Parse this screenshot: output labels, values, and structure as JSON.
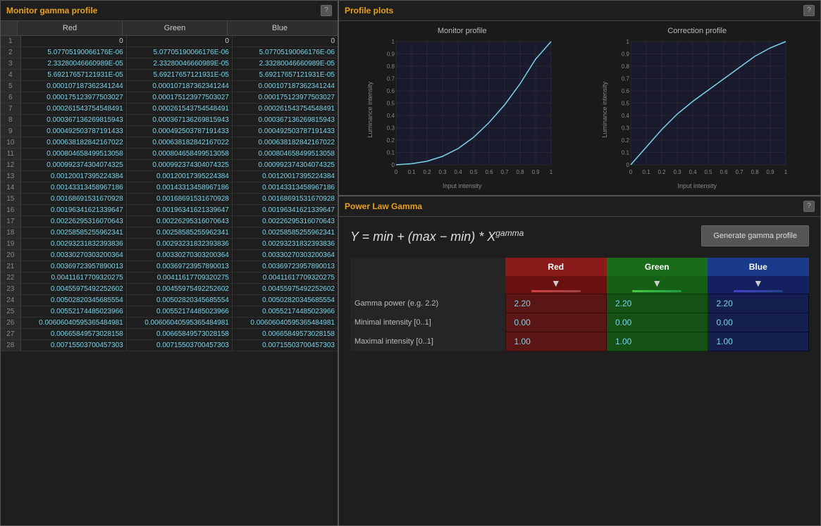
{
  "leftPanel": {
    "title": "Monitor gamma profile",
    "help": "?",
    "columns": [
      "Red",
      "Green",
      "Blue"
    ],
    "rows": [
      {
        "num": 1,
        "r": "0",
        "g": "0",
        "b": "0"
      },
      {
        "num": 2,
        "r": "5.07705190066176E-06",
        "g": "5.07705190066176E-06",
        "b": "5.07705190066176E-06"
      },
      {
        "num": 3,
        "r": "2.33280046660989E-05",
        "g": "2.33280046660989E-05",
        "b": "2.33280046660989E-05"
      },
      {
        "num": 4,
        "r": "5.69217657121931E-05",
        "g": "5.69217657121931E-05",
        "b": "5.69217657121931E-05"
      },
      {
        "num": 5,
        "r": "0.000107187362341244",
        "g": "0.000107187362341244",
        "b": "0.000107187362341244"
      },
      {
        "num": 6,
        "r": "0.000175123977503027",
        "g": "0.000175123977503027",
        "b": "0.000175123977503027"
      },
      {
        "num": 7,
        "r": "0.000261543754548491",
        "g": "0.000261543754548491",
        "b": "0.000261543754548491"
      },
      {
        "num": 8,
        "r": "0.000367136269815943",
        "g": "0.000367136269815943",
        "b": "0.000367136269815943"
      },
      {
        "num": 9,
        "r": "0.000492503787191433",
        "g": "0.000492503787191433",
        "b": "0.000492503787191433"
      },
      {
        "num": 10,
        "r": "0.000638182842167022",
        "g": "0.000638182842167022",
        "b": "0.000638182842167022"
      },
      {
        "num": 11,
        "r": "0.000804658499513058",
        "g": "0.000804658499513058",
        "b": "0.000804658499513058"
      },
      {
        "num": 12,
        "r": "0.000992374304074325",
        "g": "0.000992374304074325",
        "b": "0.000992374304074325"
      },
      {
        "num": 13,
        "r": "0.00120017395224384",
        "g": "0.00120017395224384",
        "b": "0.00120017395224384"
      },
      {
        "num": 14,
        "r": "0.00143313458967186",
        "g": "0.00143313458967186",
        "b": "0.00143313458967186"
      },
      {
        "num": 15,
        "r": "0.00168691531670928",
        "g": "0.00168691531670928",
        "b": "0.00168691531670928"
      },
      {
        "num": 16,
        "r": "0.00196341621339647",
        "g": "0.00196341621339647",
        "b": "0.00196341621339647"
      },
      {
        "num": 17,
        "r": "0.00226295316070643",
        "g": "0.00226295316070643",
        "b": "0.00226295316070643"
      },
      {
        "num": 18,
        "r": "0.00258585255962341",
        "g": "0.00258585255962341",
        "b": "0.00258585255962341"
      },
      {
        "num": 19,
        "r": "0.00293231832393836",
        "g": "0.00293231832393836",
        "b": "0.00293231832393836"
      },
      {
        "num": 20,
        "r": "0.00330270303200364",
        "g": "0.00330270303200364",
        "b": "0.00330270303200364"
      },
      {
        "num": 21,
        "r": "0.00369723957890013",
        "g": "0.00369723957890013",
        "b": "0.00369723957890013"
      },
      {
        "num": 22,
        "r": "0.00411617709320275",
        "g": "0.00411617709320275",
        "b": "0.00411617709320275"
      },
      {
        "num": 23,
        "r": "0.00455975492252602",
        "g": "0.00455975492252602",
        "b": "0.00455975492252602"
      },
      {
        "num": 24,
        "r": "0.00502820345685554",
        "g": "0.00502820345685554",
        "b": "0.00502820345685554"
      },
      {
        "num": 25,
        "r": "0.00552174485023966",
        "g": "0.00552174485023966",
        "b": "0.00552174485023966"
      },
      {
        "num": 26,
        "r": "0.00606040595365484981",
        "g": "0.00606040595365484981",
        "b": "0.00606040595365484981"
      },
      {
        "num": 27,
        "r": "0.00665849573028158",
        "g": "0.00665849573028158",
        "b": "0.00665849573028158"
      },
      {
        "num": 28,
        "r": "0.00715503700457303",
        "g": "0.00715503700457303",
        "b": "0.00715503700457303"
      }
    ]
  },
  "rightPanel": {
    "plotsTitle": "Profile plots",
    "plotsHelp": "?",
    "monitorProfileTitle": "Monitor profile",
    "correctionProfileTitle": "Correction profile",
    "yAxisLabel": "Luminance intensity",
    "xAxisLabel": "Input intensity",
    "powerTitle": "Power Law Gamma",
    "powerHelp": "?",
    "formulaDisplay": "Y = min + (max − min) * X",
    "generateBtn": "Generate gamma profile",
    "columns": {
      "red": "Red",
      "green": "Green",
      "blue": "Blue"
    },
    "gammaLabel": "Gamma power (e.g. 2.2)",
    "minLabel": "Minimal intensity [0..1]",
    "maxLabel": "Maximal intensity [0..1]",
    "redGamma": "2.20",
    "greenGamma": "2.20",
    "blueGamma": "2.20",
    "redMin": "0.00",
    "greenMin": "0.00",
    "blueMin": "0.00",
    "redMax": "1.00",
    "greenMax": "1.00",
    "blueMax": "1.00",
    "yTicks": [
      "1",
      "0.9",
      "0.8",
      "0.7",
      "0.6",
      "0.5",
      "0.4",
      "0.3",
      "0.2",
      "0.1",
      "0"
    ],
    "xTicks": [
      "0",
      "0.1",
      "0.2",
      "0.3",
      "0.4",
      "0.5",
      "0.6",
      "0.7",
      "0.8",
      "0.9",
      "1"
    ]
  }
}
